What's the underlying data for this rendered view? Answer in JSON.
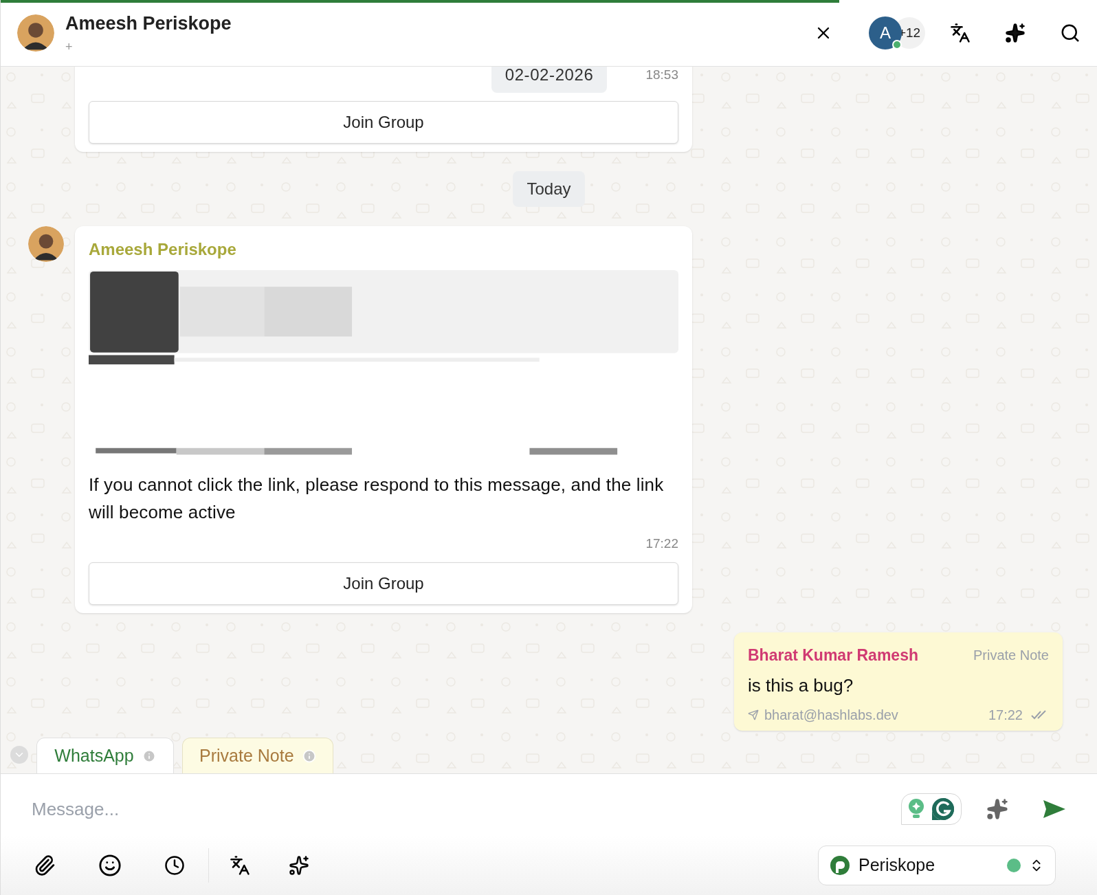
{
  "progress": {
    "level": 0.765
  },
  "header": {
    "name": "Ameesh Periskope",
    "subtitle": "+",
    "members_avatar": "A",
    "members_extra": "+12"
  },
  "messages": [
    {
      "kind": "incoming",
      "date_chip": "02-02-2026",
      "time": "18:53",
      "button": "Join Group"
    },
    {
      "kind": "day",
      "label": "Today"
    },
    {
      "kind": "incoming",
      "sender": "Ameesh Periskope",
      "has_picture": true,
      "text": "If you cannot click the link, please respond to this message, and the link will become active",
      "time": "17:22",
      "button": "Join Group"
    },
    {
      "kind": "note",
      "sender": "Bharat Kumar Ramesh",
      "tag": "Private Note",
      "text": "is this a bug?",
      "email": "bharat@hashlabs.dev",
      "time": "17:22"
    }
  ],
  "tabs": [
    {
      "label": "WhatsApp",
      "kind": "channel",
      "selected": true
    },
    {
      "label": "Private Note",
      "kind": "note",
      "selected": false
    }
  ],
  "composer": {
    "placeholder": "Message..."
  },
  "sender_account": {
    "name": "Periskope",
    "online": true
  }
}
